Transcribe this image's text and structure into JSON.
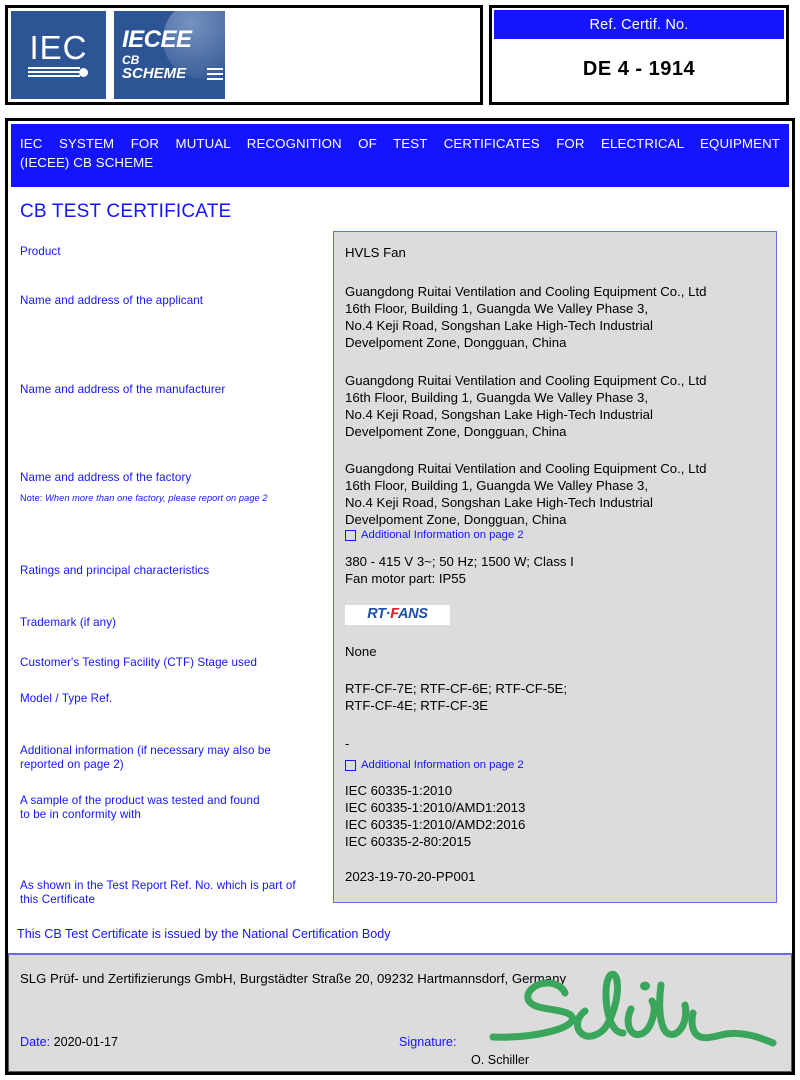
{
  "header": {
    "logo_iec_text": "IEC",
    "logo_iecee_text": "IECEE",
    "logo_iecee_cb": "CB",
    "logo_iecee_scheme": "SCHEME",
    "ref_title": "Ref. Certif. No.",
    "ref_value": "DE 4 - 1914"
  },
  "banner": {
    "line1": "IEC SYSTEM FOR MUTUAL RECOGNITION OF TEST CERTIFICATES FOR ELECTRICAL EQUIPMENT",
    "line2": "(IECEE) CB SCHEME"
  },
  "certificate_title": "CB TEST CERTIFICATE",
  "fields": [
    {
      "label": "Product",
      "value": "HVLS Fan"
    },
    {
      "label": "Name and address of the applicant",
      "value": "Guangdong Ruitai Ventilation and Cooling Equipment Co., Ltd\n16th Floor, Building 1, Guangda We Valley Phase 3,\nNo.4 Keji Road, Songshan Lake High-Tech Industrial\nDevelpoment Zone, Dongguan, China"
    },
    {
      "label": "Name and address of the manufacturer",
      "value": "Guangdong Ruitai Ventilation and Cooling Equipment Co., Ltd\n16th Floor, Building 1, Guangda We Valley Phase 3,\nNo.4 Keji Road, Songshan Lake High-Tech Industrial\nDevelpoment Zone, Dongguan, China"
    },
    {
      "label": "Name and address of the factory",
      "note_prefix": "Note:",
      "note": "When more than one factory, please report on page 2",
      "value": "Guangdong Ruitai Ventilation and Cooling Equipment Co., Ltd\n16th Floor, Building 1, Guangda We Valley Phase 3,\nNo.4 Keji Road, Songshan Lake High-Tech Industrial\nDevelpoment Zone, Dongguan, China",
      "additional_link": "Additional Information on page 2"
    },
    {
      "label": "Ratings and principal characteristics",
      "value": "380 - 415 V 3~; 50 Hz; 1500 W; Class I\nFan motor part: IP55"
    },
    {
      "label": "Trademark (if any)",
      "value": "RT·FANS",
      "logo_parts": {
        "blue1": "RT·",
        "red": "F",
        "blue2": "ANS"
      }
    },
    {
      "label": "Customer's Testing Facility (CTF) Stage used",
      "value": "None"
    },
    {
      "label": "Model / Type Ref.",
      "value": "RTF-CF-7E; RTF-CF-6E; RTF-CF-5E;\nRTF-CF-4E; RTF-CF-3E"
    },
    {
      "label": "Additional information (if necessary may also be\nreported on page 2)",
      "value": "-",
      "additional_link": "Additional Information on page 2"
    },
    {
      "label": "A sample of the product was tested and found\nto be in conformity with",
      "value": "IEC 60335-1:2010\nIEC 60335-1:2010/AMD1:2013\nIEC 60335-1:2010/AMD2:2016\nIEC 60335-2-80:2015"
    },
    {
      "label": "As shown in the Test Report Ref. No. which is part of\nthis Certificate",
      "value": "2023-19-70-20-PP001"
    }
  ],
  "issued_by_text": "This CB Test Certificate is issued by the National Certification Body",
  "footer": {
    "body_name": "SLG Prüf- und Zertifizierungs GmbH, Burgstädter Straße 20, 09232 Hartmannsdorf, Germany",
    "date_label": "Date:",
    "date_value": "2020-01-17",
    "signature_label": "Signature:",
    "signature_name": "O. Schiller",
    "signature_color": "#3aa65c"
  },
  "colors": {
    "brand_blue": "#1414ff",
    "logo_blue": "#2d5596",
    "content_gray": "#dcdcdc",
    "box_border": "#6a6aea"
  }
}
